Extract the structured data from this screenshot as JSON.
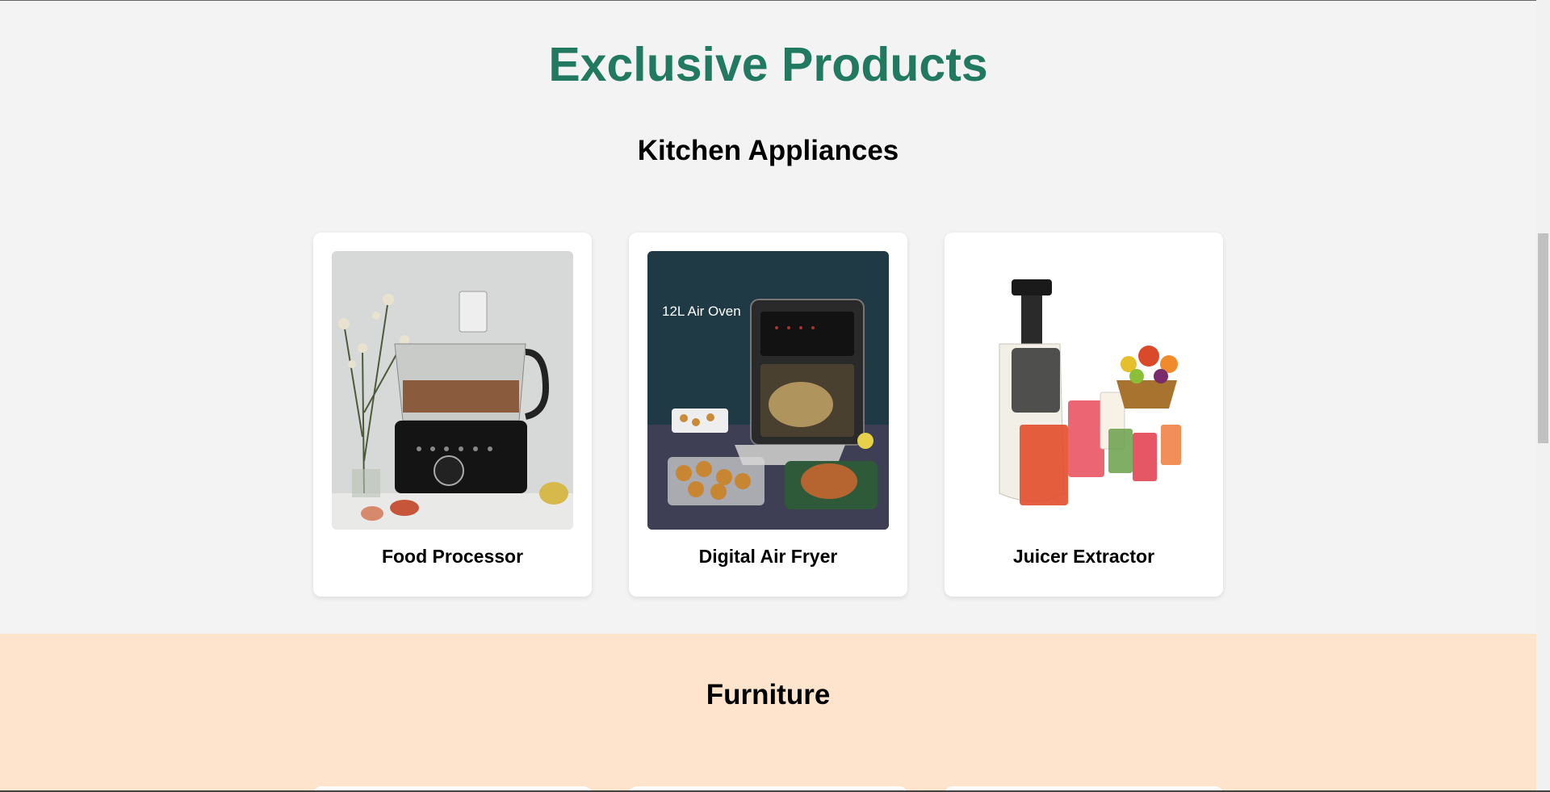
{
  "page": {
    "title": "Exclusive Products"
  },
  "sections": {
    "kitchen": {
      "title": "Kitchen Appliances",
      "products": [
        {
          "name": "Food Processor",
          "image": "food-processor-image"
        },
        {
          "name": "Digital Air Fryer",
          "image": "air-fryer-image",
          "image_text": "12L Air Oven"
        },
        {
          "name": "Juicer Extractor",
          "image": "juicer-image"
        }
      ]
    },
    "furniture": {
      "title": "Furniture"
    }
  },
  "colors": {
    "title_green": "#217a5f",
    "page_bg": "#f3f3f3",
    "furniture_bg": "#ffe4cd",
    "card_bg": "#ffffff"
  }
}
